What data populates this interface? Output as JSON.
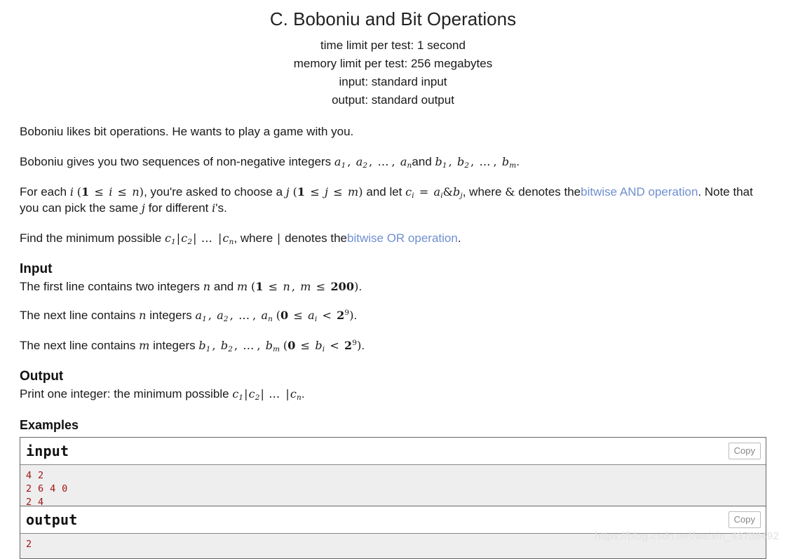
{
  "problem": {
    "title": "C. Boboniu and Bit Operations",
    "limits": [
      "time limit per test: 1 second",
      "memory limit per test: 256 megabytes",
      "input: standard input",
      "output: standard output"
    ]
  },
  "statement": {
    "p1": "Boboniu likes bit operations. He wants to play a game with you.",
    "p2_prefix": "Boboniu gives you two sequences of non-negative integers",
    "p2_math1": "a1, a2, …, an",
    "p2_and": "and",
    "p2_math2": "b1, b2, …, bm",
    "p2_period": ".",
    "p3_a": "For each",
    "p3_i": "i",
    "p3_range_i": "(1 ≤ i ≤ n)",
    "p3_b": ", you're asked to choose a",
    "p3_j": "j",
    "p3_range_j": "(1 ≤ j ≤ m)",
    "p3_c": "and let",
    "p3_ci": "ci = ai&bj",
    "p3_d": ", where",
    "p3_amp": "&",
    "p3_e": "denotes the",
    "p3_link": "bitwise AND operation",
    "p3_f": ". Note that you can pick the same",
    "p3_j2": "j",
    "p3_g": "for different",
    "p3_i2": "i",
    "p3_h": "'s.",
    "p4_a": "Find the minimum possible",
    "p4_math": "c1|c2| … |cn",
    "p4_b": ", where",
    "p4_bar": "|",
    "p4_c": "denotes the",
    "p4_link": "bitwise OR operation",
    "p4_d": "."
  },
  "input_section": {
    "heading": "Input",
    "line1_a": "The first line contains two integers",
    "line1_n": "n",
    "line1_and": "and",
    "line1_m": "m",
    "line1_range": "(1 ≤ n, m ≤ 200)",
    "line1_end": ".",
    "line2_a": "The next line contains",
    "line2_n": "n",
    "line2_b": "integers",
    "line2_seq": "a1, a2, …, an",
    "line2_range": "(0 ≤ ai < 2^9)",
    "line2_end": ".",
    "line3_a": "The next line contains",
    "line3_m": "m",
    "line3_b": "integers",
    "line3_seq": "b1, b2, …, bm",
    "line3_range": "(0 ≤ bi < 2^9)",
    "line3_end": ".",
    "exponent": "9",
    "bound": "200"
  },
  "output_section": {
    "heading": "Output",
    "line_a": "Print one integer: the minimum possible",
    "line_math": "c1|c2| … |cn",
    "line_end": "."
  },
  "examples": {
    "heading": "Examples",
    "tests": [
      {
        "input_label": "input",
        "input_copy_label": "Copy",
        "input_data": "4 2\n2 6 4 0\n2 4",
        "output_label": "output",
        "output_copy_label": "Copy",
        "output_data": "2"
      }
    ]
  },
  "watermark": "https://blog.csdn.net/weixin_43736492",
  "colors": {
    "link": "#6f8fd0",
    "code_text": "#a31515",
    "code_bg": "#eeeeee",
    "border": "#666666",
    "watermark": "#e2e2e2"
  }
}
